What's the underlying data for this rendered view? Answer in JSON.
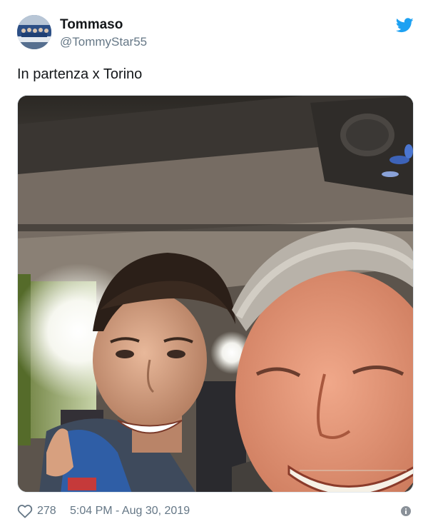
{
  "tweet": {
    "author": {
      "name": "Tommaso",
      "handle": "@TommyStar55",
      "avatar_icon": "avatar-photo"
    },
    "text": "In partenza x Torino",
    "media": {
      "type": "photo",
      "icon": "photo-selfie"
    },
    "likes": "278",
    "timestamp": "5:04 PM - Aug 30, 2019",
    "icons": {
      "brand": "twitter-bird-icon",
      "like": "heart-icon",
      "info": "info-icon"
    },
    "colors": {
      "brand": "#1da1f2",
      "text_primary": "#14171a",
      "text_secondary": "#657786"
    }
  }
}
